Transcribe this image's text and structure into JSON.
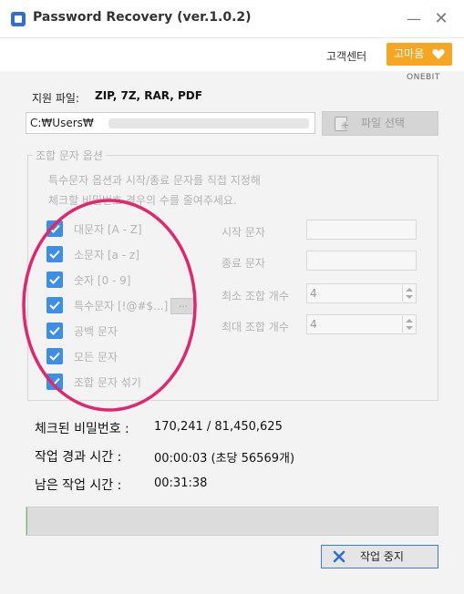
{
  "window": {
    "title": "Password Recovery (ver.1.0.2)",
    "minimize_glyph": "—",
    "close_glyph": "✕"
  },
  "header": {
    "support_label": "고객센터",
    "thanks_label": "고마움",
    "brand": "ONEBIT"
  },
  "formats": {
    "label": "지원 파일:",
    "value": "ZIP, 7Z, RAR, PDF"
  },
  "file": {
    "path_value": "C:₩Users₩",
    "select_label": "파일 선택"
  },
  "options": {
    "legend": "조합 문자 옵션",
    "description_line1": "특수문자 옵션과 시작/종료 문자를 직접 지정해",
    "description_line2": "체크할 비밀번호 경우의 수를 줄여주세요.",
    "checkboxes": [
      {
        "label": "대문자 [A - Z]",
        "checked": true
      },
      {
        "label": "소문자 [a - z]",
        "checked": true
      },
      {
        "label": "숫자 [0 - 9]",
        "checked": true
      },
      {
        "label": "특수문자 [!@#$...]",
        "checked": true
      },
      {
        "label": "공백 문자",
        "checked": true
      },
      {
        "label": "모든 문자",
        "checked": true
      },
      {
        "label": "조합 문자 섞기",
        "checked": true
      }
    ],
    "special_button": "...",
    "start_char_label": "시작 문자",
    "start_char_value": "",
    "end_char_label": "종료 문자",
    "end_char_value": "",
    "min_len_label": "최소 조합 개수",
    "min_len_value": "4",
    "max_len_label": "최대 조합 개수",
    "max_len_value": "4"
  },
  "stats": {
    "checked_label": "체크된 비밀번호 :",
    "checked_value": "170,241 / 81,450,625",
    "elapsed_label": "작업 경과 시간 :",
    "elapsed_value": "00:00:03 (초당 56569개)",
    "remaining_label": "남은 작업 시간 :",
    "remaining_value": "00:31:38"
  },
  "progress": {
    "fraction": 0.0021
  },
  "actions": {
    "stop_label": "작업 중지"
  },
  "colors": {
    "accent_orange": "#f5a623",
    "checkbox_blue": "#3c8ee6",
    "annotation_pink": "#e0266e",
    "stop_icon_blue": "#2f6fd0"
  }
}
